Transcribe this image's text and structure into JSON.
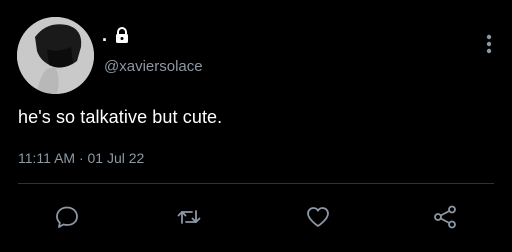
{
  "tweet": {
    "display_name": ".",
    "lock_icon": "lock-icon",
    "handle": "@xaviersolace",
    "text": "he's so talkative but cute.",
    "timestamp": "11:11 AM · 01 Jul 22"
  },
  "actions": [
    {
      "name": "reply",
      "icon": "speech-bubble-icon"
    },
    {
      "name": "retweet",
      "icon": "retweet-icon"
    },
    {
      "name": "like",
      "icon": "heart-icon"
    },
    {
      "name": "share",
      "icon": "share-icon"
    }
  ],
  "colors": {
    "background": "#000000",
    "text": "#ffffff",
    "secondary_text": "#8b98a5",
    "divider": "#2f3336"
  }
}
